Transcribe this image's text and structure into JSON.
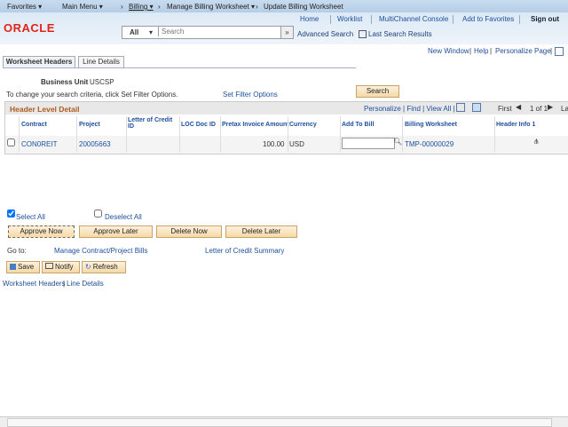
{
  "nav": {
    "favorites": "Favorites ▾",
    "main_menu": "Main Menu ▾",
    "crumbs": [
      "Billing ▾",
      "Manage Billing Worksheet ▾",
      "Update Billing Worksheet"
    ]
  },
  "header": {
    "logo": "ORACLE",
    "links": [
      "Home",
      "Worklist",
      "MultiChannel Console",
      "Add to Favorites",
      "Sign out"
    ],
    "search_scope": "All",
    "search_placeholder": "Search",
    "advanced_search": "Advanced Search",
    "last_results": "Last Search Results"
  },
  "page_links": [
    "New Window",
    "Help",
    "Personalize Page"
  ],
  "tabs": [
    "Worksheet Headers",
    "Line Details"
  ],
  "filter": {
    "bu_label": "Business Unit",
    "bu_value": "USCSP",
    "hint": "To change your search criteria, click Set Filter Options.",
    "set_filter": "Set Filter Options",
    "search_btn": "Search"
  },
  "grid": {
    "title": "Header Level Detail",
    "tools": "Personalize | Find | View All |",
    "first": "First",
    "count": "1 of 1",
    "last": "La",
    "columns": [
      "Contract",
      "Project",
      "Letter of Credit ID",
      "LOC Doc ID",
      "Pretax Invoice Amount",
      "Currency",
      "Add To Bill",
      "Billing Worksheet",
      "Header Info 1"
    ],
    "rows": [
      {
        "contract": "CON0REIT",
        "project": "20005663",
        "loc": "",
        "locdoc": "",
        "amount": "100.00",
        "currency": "USD",
        "add_to_bill": "",
        "worksheet": "TMP-00000029"
      }
    ]
  },
  "actions": {
    "select_all": "Select All",
    "deselect_all": "Deselect All",
    "buttons": [
      "Approve Now",
      "Approve Later",
      "Delete Now",
      "Delete Later"
    ]
  },
  "goto": {
    "label": "Go to:",
    "links": [
      "Manage Contract/Project Bills",
      "Letter of Credit Summary"
    ]
  },
  "toolbar": {
    "save": "Save",
    "notify": "Notify",
    "refresh": "Refresh"
  },
  "footer_links": [
    "Worksheet Headers",
    "Line Details"
  ]
}
